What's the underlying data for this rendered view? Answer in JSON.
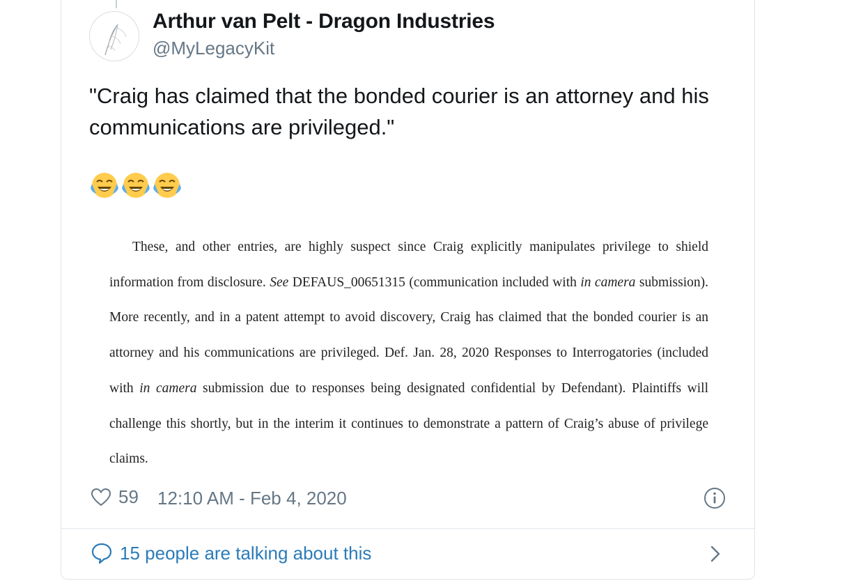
{
  "tweet": {
    "author": {
      "display_name": "Arthur van Pelt - Dragon Industries",
      "handle": "@MyLegacyKit",
      "avatar_icon": "feather-quill-icon"
    },
    "text": "\"Craig has claimed that the bonded courier is an attorney and his communications are privileged.\"",
    "emojis": [
      "face-with-tears-of-joy",
      "face-with-tears-of-joy",
      "face-with-tears-of-joy"
    ],
    "attached_document": {
      "seg1": "These, and other entries, are highly suspect since Craig explicitly manipulates privilege to shield information from disclosure. ",
      "seg2_italic": "See",
      "seg3": " DEFAUS_00651315 (communication included with ",
      "seg4_italic": "in camera",
      "seg5": " submission). More recently, and in a patent attempt to avoid discovery, Craig has claimed that the bonded courier is an attorney and his communications are privileged. Def. Jan. 28, 2020 Responses to Interrogatories (included with ",
      "seg6_italic": "in camera",
      "seg7": " submission due to responses being designated confidential by Defendant). Plaintiffs will challenge this shortly, but in the interim it continues to demonstrate a pattern of Craig’s abuse of privilege claims."
    },
    "likes_count": "59",
    "timestamp": "12:10 AM - Feb 4, 2020",
    "conversation_link": "15 people are talking about this"
  },
  "colors": {
    "text_primary": "#14171a",
    "text_secondary": "#657786",
    "link": "#2b7bb9",
    "border": "#e1e8ed"
  }
}
